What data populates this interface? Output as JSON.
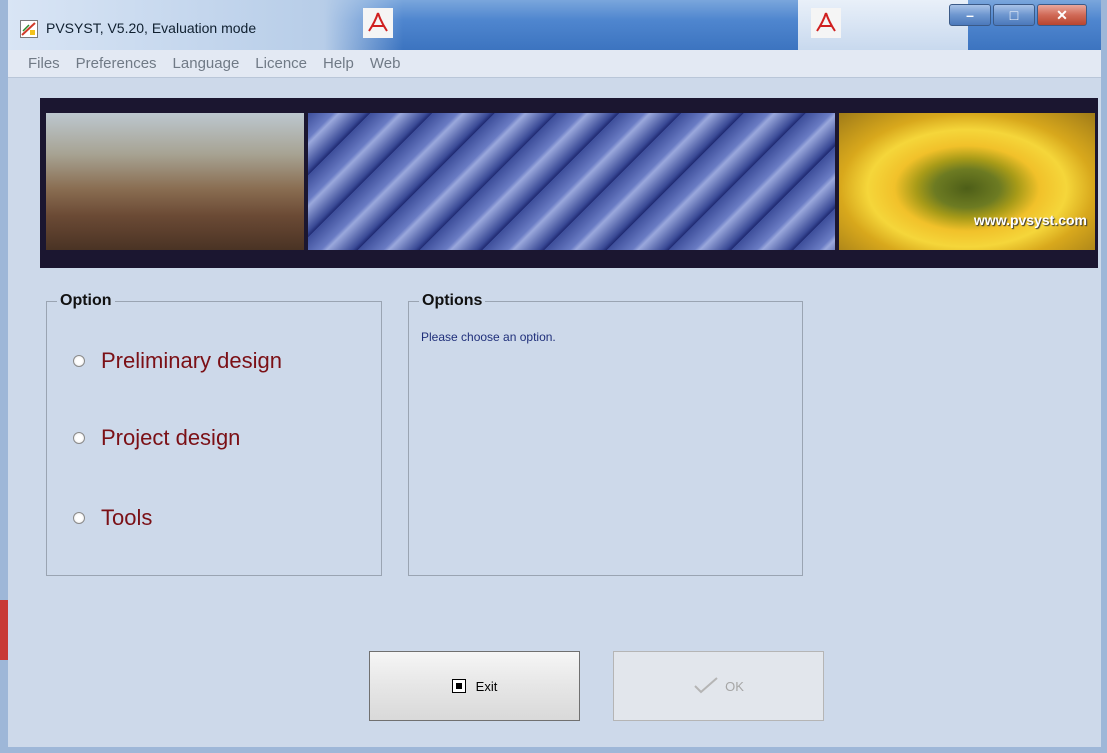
{
  "window": {
    "title": "PVSYST, V5.20,  Evaluation mode",
    "buttons": {
      "minimize": "–",
      "maximize": "□",
      "close": "✕"
    }
  },
  "menu": {
    "items": [
      "Files",
      "Preferences",
      "Language",
      "Licence",
      "Help",
      "Web"
    ]
  },
  "banner": {
    "url": "www.pvsyst.com"
  },
  "option_group": {
    "title": "Option",
    "radios": [
      {
        "label": "Preliminary design",
        "selected": false
      },
      {
        "label": "Project design",
        "selected": false
      },
      {
        "label": "Tools",
        "selected": false
      }
    ]
  },
  "options_group": {
    "title": "Options",
    "hint": "Please choose an option."
  },
  "buttons": {
    "exit": "Exit",
    "ok": "OK"
  },
  "colors": {
    "window_bg": "#cdd9ea",
    "radio_text": "#7b1016",
    "hint_text": "#1f2f7a"
  }
}
